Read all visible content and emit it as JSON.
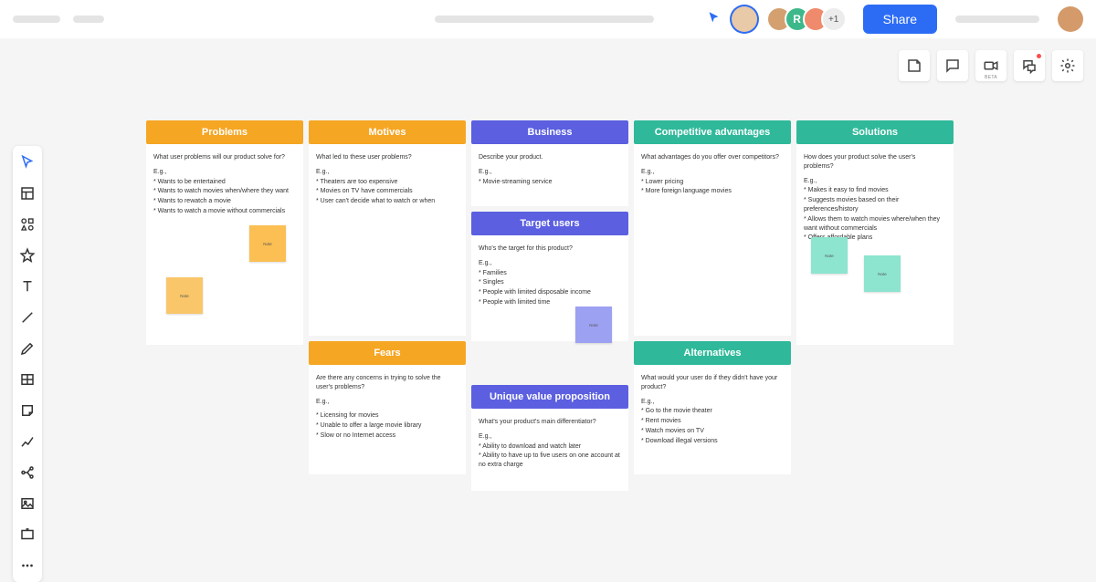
{
  "topbar": {
    "share_label": "Share",
    "overflow_count": "+1"
  },
  "avatars": {
    "active": "#e8c9a8",
    "stack": [
      "#d4a070",
      "#3db88a",
      "#f08a6c"
    ],
    "self": "#d49a6a"
  },
  "tr_toolbar": {
    "beta_label": "BETA"
  },
  "columns": {
    "problems": {
      "title": "Problems",
      "question": "What user problems will our product solve for?",
      "eg": "E.g.,",
      "l1": "* Wants to be entertained",
      "l2": "* Wants to watch movies when/where they want",
      "l3": "* Wants to rewatch a movie",
      "l4": "* Wants to watch a movie without commercials"
    },
    "motives": {
      "title": "Motives",
      "question": "What led to these user problems?",
      "eg": "E.g.,",
      "l1": "* Theaters are too expensive",
      "l2": "* Movies on TV have commercials",
      "l3": "* User can't decide what to watch or when"
    },
    "fears": {
      "title": "Fears",
      "question": "Are there any concerns in trying to solve the user's problems?",
      "eg": "E.g.,",
      "l1": "* Licensing for movies",
      "l2": "* Unable to offer a large movie library",
      "l3": "* Slow or no Internet access"
    },
    "business": {
      "title": "Business",
      "question": "Describe your product.",
      "eg": "E.g.,",
      "l1": "* Movie-streaming service"
    },
    "target_users": {
      "title": "Target users",
      "question": "Who's the target for this product?",
      "eg": "E.g.,",
      "l1": "* Families",
      "l2": "* Singles",
      "l3": "* People with limited disposable income",
      "l4": "* People with limited time"
    },
    "uvp": {
      "title": "Unique value proposition",
      "question": "What's your product's main differentiator?",
      "eg": "E.g.,",
      "l1": "* Ability to download and watch later",
      "l2": "* Ability to have up to five users on one account at no extra charge"
    },
    "competitive": {
      "title": "Competitive advantages",
      "question": "What advantages do you offer over competitors?",
      "eg": "E.g.,",
      "l1": "* Lower pricing",
      "l2": "* More foreign language movies"
    },
    "alternatives": {
      "title": "Alternatives",
      "question": "What would your user do if they didn't have your product?",
      "eg": "E.g.,",
      "l1": "* Go to the movie theater",
      "l2": "* Rent movies",
      "l3": "* Watch movies on TV",
      "l4": "* Download illegal versions"
    },
    "solutions": {
      "title": "Solutions",
      "question": "How does your product solve the user's problems?",
      "eg": "E.g.,",
      "l1": "* Makes it easy to find movies",
      "l2": "* Suggests movies based on their preferences/history",
      "l3": "* Allows them to watch movies where/when they want without commercials",
      "l4": "* Offers affordable plans"
    }
  },
  "sticky_label": "Note"
}
